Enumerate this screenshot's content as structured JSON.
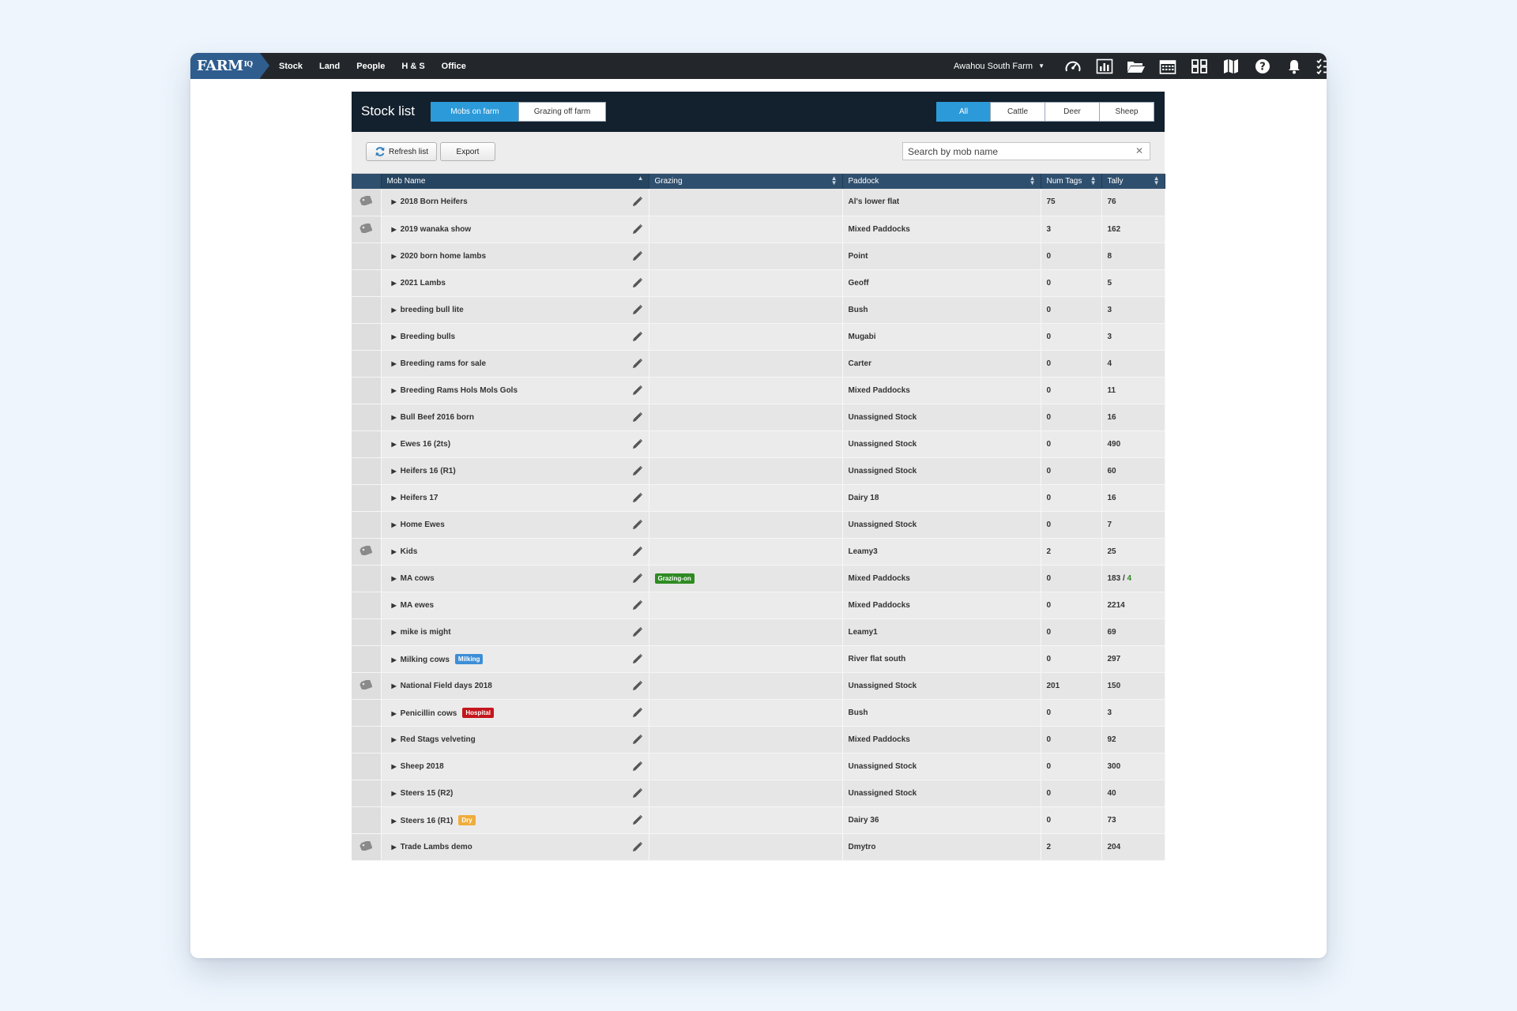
{
  "app": {
    "logo_text": "FARM",
    "logo_sup": "IQ",
    "nav": [
      "Stock",
      "Land",
      "People",
      "H & S",
      "Office"
    ],
    "farm_name": "Awahou South Farm",
    "top_icons": [
      "dashboard-icon",
      "reports-chart-icon",
      "folder-icon",
      "calendar-icon",
      "grid-icon",
      "map-icon",
      "help-icon",
      "notifications-bell-icon",
      "task-list-icon"
    ]
  },
  "panel": {
    "title": "Stock list",
    "location_tabs": [
      "Mobs on farm",
      "Grazing off farm"
    ],
    "location_active": 0,
    "species_tabs": [
      "All",
      "Cattle",
      "Deer",
      "Sheep"
    ],
    "species_active": 0,
    "refresh_label": "Refresh list",
    "export_label": "Export",
    "search_placeholder": "Search by mob name"
  },
  "table": {
    "columns": [
      "",
      "Mob Name",
      "Grazing",
      "Paddock",
      "Num Tags",
      "Tally"
    ],
    "rows": [
      {
        "tag": true,
        "name": "2018 Born Heifers",
        "badge": null,
        "grazing": null,
        "paddock": "Al's lower flat",
        "num_tags": "75",
        "tally": "76"
      },
      {
        "tag": true,
        "name": "2019 wanaka show",
        "badge": null,
        "grazing": null,
        "paddock": "Mixed Paddocks",
        "num_tags": "3",
        "tally": "162"
      },
      {
        "tag": false,
        "name": "2020 born home lambs",
        "badge": null,
        "grazing": null,
        "paddock": "Point",
        "num_tags": "0",
        "tally": "8"
      },
      {
        "tag": false,
        "name": "2021 Lambs",
        "badge": null,
        "grazing": null,
        "paddock": "Geoff",
        "num_tags": "0",
        "tally": "5"
      },
      {
        "tag": false,
        "name": "breeding bull lite",
        "badge": null,
        "grazing": null,
        "paddock": "Bush",
        "num_tags": "0",
        "tally": "3"
      },
      {
        "tag": false,
        "name": "Breeding bulls",
        "badge": null,
        "grazing": null,
        "paddock": "Mugabi",
        "num_tags": "0",
        "tally": "3"
      },
      {
        "tag": false,
        "name": "Breeding rams for sale",
        "badge": null,
        "grazing": null,
        "paddock": "Carter",
        "num_tags": "0",
        "tally": "4"
      },
      {
        "tag": false,
        "name": "Breeding Rams Hols Mols Gols",
        "badge": null,
        "grazing": null,
        "paddock": "Mixed Paddocks",
        "num_tags": "0",
        "tally": "11"
      },
      {
        "tag": false,
        "name": "Bull Beef 2016 born",
        "badge": null,
        "grazing": null,
        "paddock": "Unassigned Stock",
        "num_tags": "0",
        "tally": "16"
      },
      {
        "tag": false,
        "name": "Ewes 16 (2ts)",
        "badge": null,
        "grazing": null,
        "paddock": "Unassigned Stock",
        "num_tags": "0",
        "tally": "490"
      },
      {
        "tag": false,
        "name": "Heifers 16 (R1)",
        "badge": null,
        "grazing": null,
        "paddock": "Unassigned Stock",
        "num_tags": "0",
        "tally": "60"
      },
      {
        "tag": false,
        "name": "Heifers 17",
        "badge": null,
        "grazing": null,
        "paddock": "Dairy 18",
        "num_tags": "0",
        "tally": "16"
      },
      {
        "tag": false,
        "name": "Home Ewes",
        "badge": null,
        "grazing": null,
        "paddock": "Unassigned Stock",
        "num_tags": "0",
        "tally": "7"
      },
      {
        "tag": true,
        "name": "Kids",
        "badge": null,
        "grazing": null,
        "paddock": "Leamy3",
        "num_tags": "2",
        "tally": "25"
      },
      {
        "tag": false,
        "name": "MA cows",
        "badge": null,
        "grazing": "Grazing-on",
        "paddock": "Mixed Paddocks",
        "num_tags": "0",
        "tally": "183 / ",
        "tally_extra": "4"
      },
      {
        "tag": false,
        "name": "MA ewes",
        "badge": null,
        "grazing": null,
        "paddock": "Mixed Paddocks",
        "num_tags": "0",
        "tally": "2214"
      },
      {
        "tag": false,
        "name": "mike is might",
        "badge": null,
        "grazing": null,
        "paddock": "Leamy1",
        "num_tags": "0",
        "tally": "69"
      },
      {
        "tag": false,
        "name": "Milking cows",
        "badge": "Milking",
        "badge_type": "milking",
        "grazing": null,
        "paddock": "River flat south",
        "num_tags": "0",
        "tally": "297"
      },
      {
        "tag": true,
        "name": "National Field days 2018",
        "badge": null,
        "grazing": null,
        "paddock": "Unassigned Stock",
        "num_tags": "201",
        "tally": "150"
      },
      {
        "tag": false,
        "name": "Penicillin cows",
        "badge": "Hospital",
        "badge_type": "hospital",
        "grazing": null,
        "paddock": "Bush",
        "num_tags": "0",
        "tally": "3"
      },
      {
        "tag": false,
        "name": "Red Stags velveting",
        "badge": null,
        "grazing": null,
        "paddock": "Mixed Paddocks",
        "num_tags": "0",
        "tally": "92"
      },
      {
        "tag": false,
        "name": "Sheep 2018",
        "badge": null,
        "grazing": null,
        "paddock": "Unassigned Stock",
        "num_tags": "0",
        "tally": "300"
      },
      {
        "tag": false,
        "name": "Steers 15 (R2)",
        "badge": null,
        "grazing": null,
        "paddock": "Unassigned Stock",
        "num_tags": "0",
        "tally": "40"
      },
      {
        "tag": false,
        "name": "Steers 16 (R1)",
        "badge": "Dry",
        "badge_type": "dry",
        "grazing": null,
        "paddock": "Dairy 36",
        "num_tags": "0",
        "tally": "73"
      },
      {
        "tag": true,
        "name": "Trade Lambs demo",
        "badge": null,
        "grazing": null,
        "paddock": "Dmytro",
        "num_tags": "2",
        "tally": "204"
      }
    ]
  }
}
